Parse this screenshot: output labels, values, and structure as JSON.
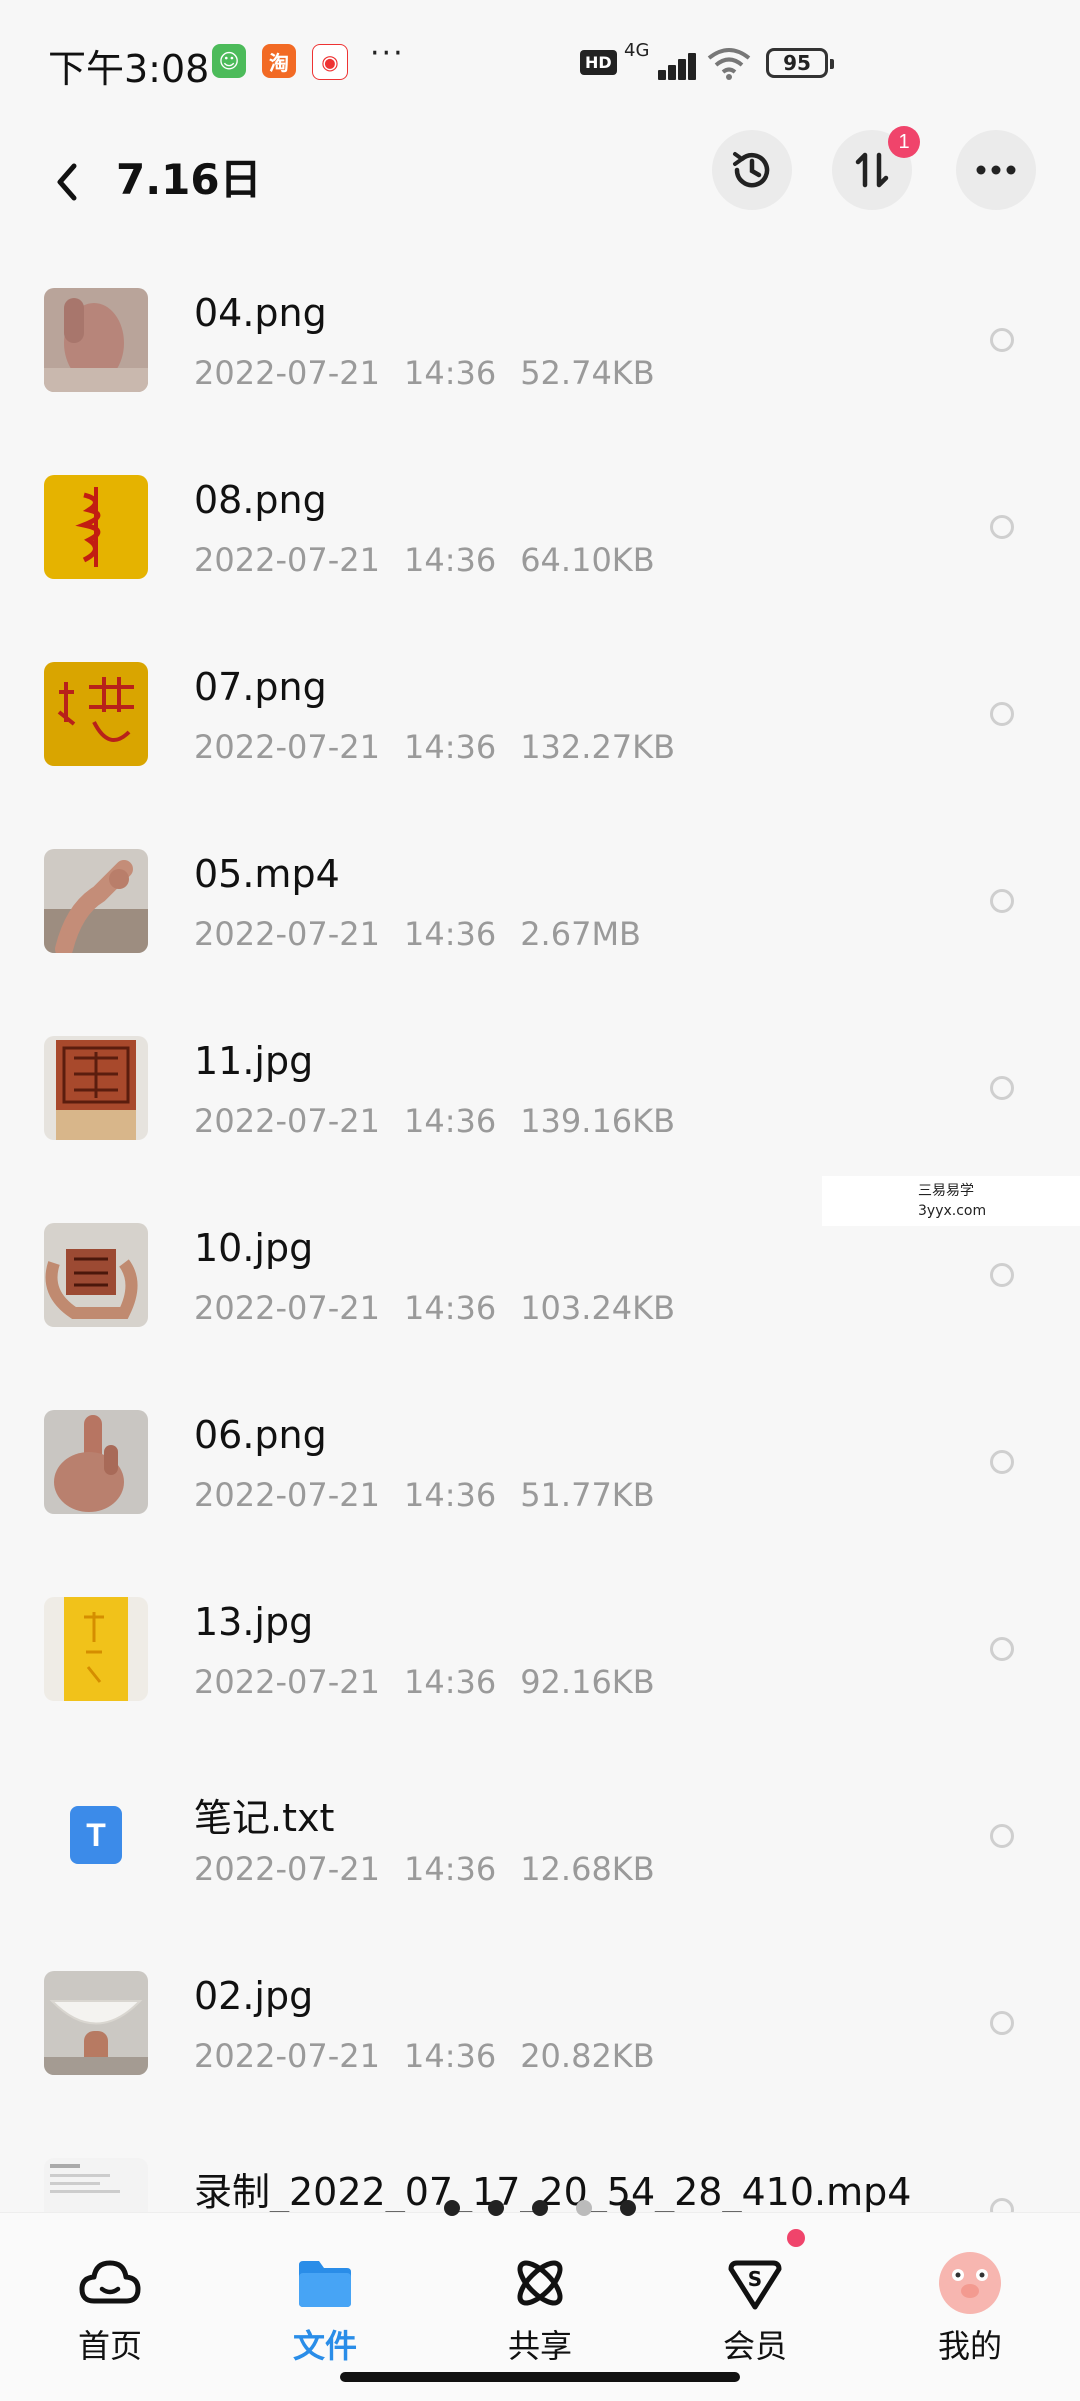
{
  "status_bar": {
    "time": "下午3:08",
    "more_dots": "···",
    "hd": "HD",
    "network": "4G",
    "battery": "95"
  },
  "header": {
    "title": "7.16日",
    "transfer_badge": "1"
  },
  "files": [
    {
      "name": "04.png",
      "date": "2022-07-21",
      "time": "14:36",
      "size": "52.74KB",
      "thumb": "hand"
    },
    {
      "name": "08.png",
      "date": "2022-07-21",
      "time": "14:36",
      "size": "64.10KB",
      "thumb": "yellow-talisman"
    },
    {
      "name": "07.png",
      "date": "2022-07-21",
      "time": "14:36",
      "size": "132.27KB",
      "thumb": "yellow-talisman"
    },
    {
      "name": "05.mp4",
      "date": "2022-07-21",
      "time": "14:36",
      "size": "2.67MB",
      "thumb": "hand"
    },
    {
      "name": "11.jpg",
      "date": "2022-07-21",
      "time": "14:36",
      "size": "139.16KB",
      "thumb": "seal"
    },
    {
      "name": "10.jpg",
      "date": "2022-07-21",
      "time": "14:36",
      "size": "103.24KB",
      "thumb": "seal"
    },
    {
      "name": "06.png",
      "date": "2022-07-21",
      "time": "14:36",
      "size": "51.77KB",
      "thumb": "hand"
    },
    {
      "name": "13.jpg",
      "date": "2022-07-21",
      "time": "14:36",
      "size": "92.16KB",
      "thumb": "yellow-strip"
    },
    {
      "name": "笔记.txt",
      "date": "2022-07-21",
      "time": "14:36",
      "size": "12.68KB",
      "thumb": "txt-file-icon",
      "icon_letter": "T"
    },
    {
      "name": "02.jpg",
      "date": "2022-07-21",
      "time": "14:36",
      "size": "20.82KB",
      "thumb": "bowl"
    },
    {
      "name": "录制_2022_07_17_20_54_28_410.mp4",
      "date": "",
      "time": "",
      "size": "",
      "thumb": "screen-recording"
    }
  ],
  "watermark": {
    "line1": "三易易学",
    "line2": "3yyx.com"
  },
  "bottom_nav": [
    {
      "label": "首页",
      "icon": "cloud-home-icon",
      "active": false
    },
    {
      "label": "文件",
      "icon": "folder-icon",
      "active": true
    },
    {
      "label": "共享",
      "icon": "atom-share-icon",
      "active": false
    },
    {
      "label": "会员",
      "icon": "vip-diamond-icon",
      "active": false
    },
    {
      "label": "我的",
      "icon": "avatar-icon",
      "active": false
    }
  ],
  "colors": {
    "accent": "#2a8de8",
    "badge": "#f0446b",
    "meta_text": "#9a9a9a"
  }
}
